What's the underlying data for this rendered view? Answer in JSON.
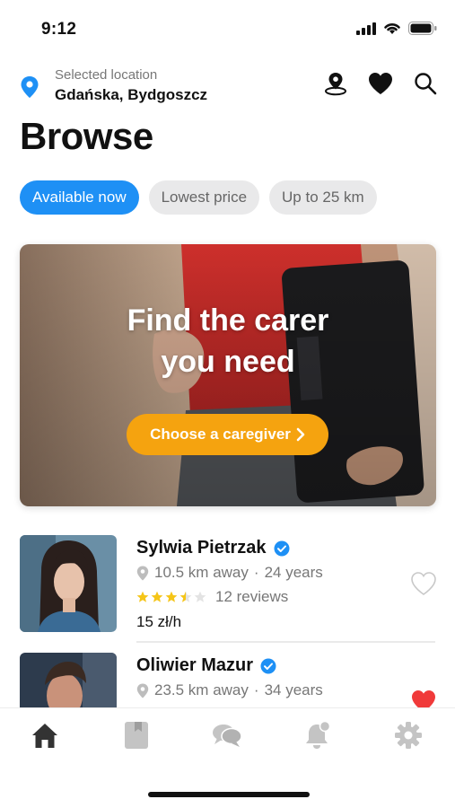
{
  "status_bar": {
    "time": "9:12"
  },
  "location": {
    "label": "Selected location",
    "value": "Gdańska, Bydgoszcz"
  },
  "actions": [
    "map-pin-icon",
    "heart-icon",
    "search-icon"
  ],
  "page_title": "Browse",
  "filters": [
    {
      "label": "Available now",
      "active": true
    },
    {
      "label": "Lowest price",
      "active": false
    },
    {
      "label": "Up to 25 km",
      "active": false
    }
  ],
  "hero": {
    "title_line1": "Find the carer",
    "title_line2": "you need",
    "cta_label": "Choose a caregiver"
  },
  "caregivers": [
    {
      "name": "Sylwia Pietrzak",
      "verified": true,
      "distance": "10.5 km away",
      "age": "24 years",
      "rating": 3.5,
      "reviews": "12 reviews",
      "price": "15 zł/h",
      "favorite": false
    },
    {
      "name": "Oliwier Mazur",
      "verified": true,
      "distance": "23.5 km away",
      "age": "34 years",
      "favorite": true
    }
  ],
  "tabs": [
    "home-icon",
    "bookings-icon",
    "messages-icon",
    "notifications-icon",
    "settings-icon"
  ],
  "colors": {
    "accent": "#1e90f5",
    "cta": "#f5a30f",
    "favorite": "#f03a3a",
    "star": "#f5c518"
  }
}
